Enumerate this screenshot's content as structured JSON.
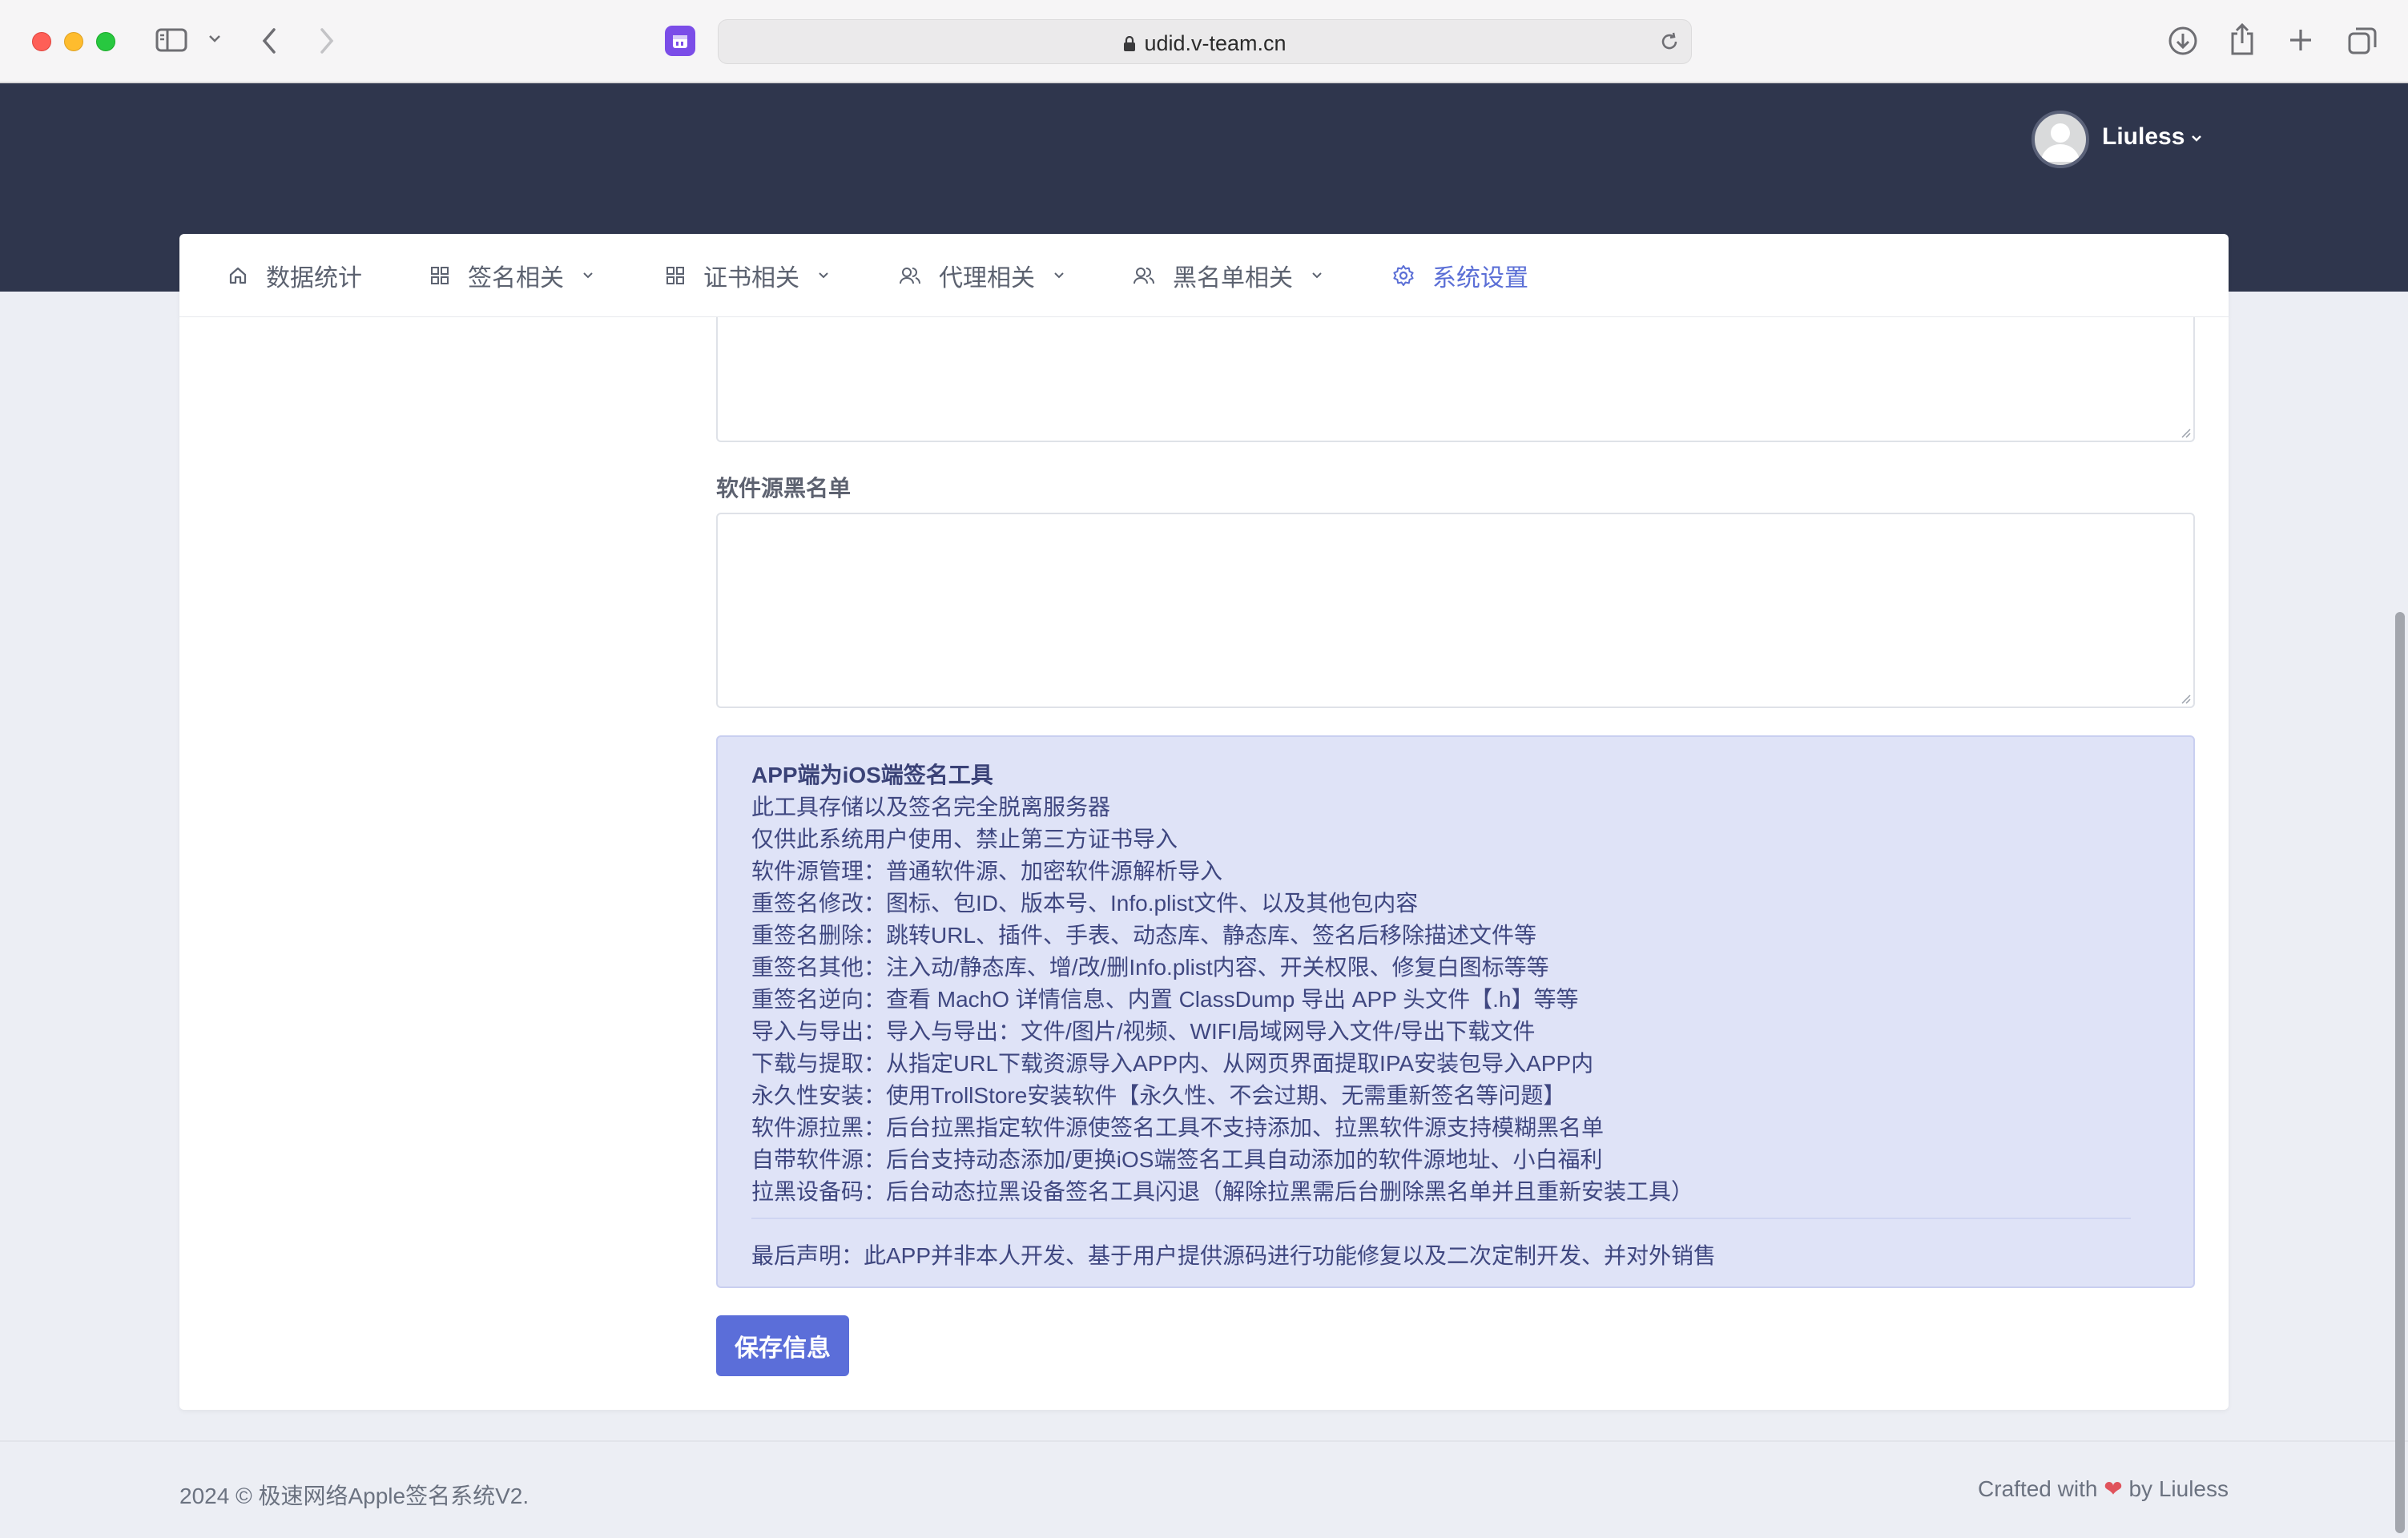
{
  "browser": {
    "url": "udid.v-team.cn",
    "extension_icon": "calendar-extension-icon"
  },
  "header": {
    "user_name": "Liuless"
  },
  "nav": {
    "items": [
      {
        "label": "数据统计",
        "icon": "home-icon",
        "has_dropdown": false,
        "active": false
      },
      {
        "label": "签名相关",
        "icon": "grid-icon",
        "has_dropdown": true,
        "active": false
      },
      {
        "label": "证书相关",
        "icon": "grid-icon",
        "has_dropdown": true,
        "active": false
      },
      {
        "label": "代理相关",
        "icon": "users-icon",
        "has_dropdown": true,
        "active": false
      },
      {
        "label": "黑名单相关",
        "icon": "users-icon",
        "has_dropdown": true,
        "active": false
      },
      {
        "label": "系统设置",
        "icon": "gear-icon",
        "has_dropdown": false,
        "active": true
      }
    ]
  },
  "form": {
    "blacklist_label": "软件源黑名单",
    "blacklist_value": "",
    "previous_textarea_value": "",
    "save_label": "保存信息"
  },
  "info": {
    "title": "APP端为iOS端签名工具",
    "lines": [
      "此工具存储以及签名完全脱离服务器",
      "仅供此系统用户使用、禁止第三方证书导入",
      "软件源管理：普通软件源、加密软件源解析导入",
      "重签名修改：图标、包ID、版本号、Info.plist文件、以及其他包内容",
      "重签名删除：跳转URL、插件、手表、动态库、静态库、签名后移除描述文件等",
      "重签名其他：注入动/静态库、增/改/删Info.plist内容、开关权限、修复白图标等等",
      "重签名逆向：查看 MachO 详情信息、内置 ClassDump 导出 APP 头文件【.h】等等",
      "导入与导出：导入与导出：文件/图片/视频、WIFI局域网导入文件/导出下载文件",
      "下载与提取：从指定URL下载资源导入APP内、从网页界面提取IPA安装包导入APP内",
      "永久性安装：使用TrollStore安装软件【永久性、不会过期、无需重新签名等问题】",
      "软件源拉黑：后台拉黑指定软件源使签名工具不支持添加、拉黑软件源支持模糊黑名单",
      "自带软件源：后台支持动态添加/更换iOS端签名工具自动添加的软件源地址、小白福利",
      "拉黑设备码：后台动态拉黑设备签名工具闪退（解除拉黑需后台删除黑名单并且重新安装工具）"
    ],
    "final_statement": "最后声明：此APP并非本人开发、基于用户提供源码进行功能修复以及二次定制开发、并对外销售"
  },
  "footer": {
    "copyright": "2024 © 极速网络Apple签名系统V2.",
    "crafted_prefix": "Crafted with",
    "heart": "❤",
    "crafted_suffix": "by Liuless"
  },
  "colors": {
    "header_bg": "#2f364d",
    "accent": "#5b6ed9",
    "info_bg": "#dfe3f7",
    "heart": "#e0535c"
  }
}
